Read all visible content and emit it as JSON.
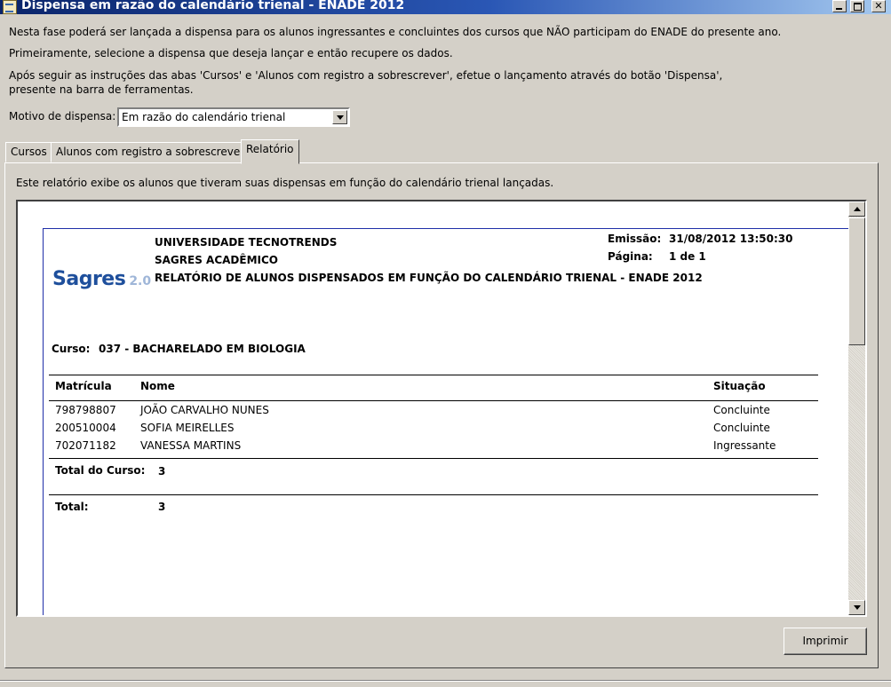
{
  "window": {
    "title": "Dispensa em razão do calendário trienal - ENADE 2012"
  },
  "intro": {
    "line1": "Nesta fase poderá ser lançada a dispensa para os alunos ingressantes e concluintes dos cursos que NÃO participam do ENADE do presente ano.",
    "line2": "Primeiramente, selecione a dispensa que deseja lançar e então recupere os dados.",
    "line3": "Após seguir as instruções das abas 'Cursos' e 'Alunos com registro a sobrescrever', efetue o lançamento através do botão 'Dispensa',",
    "line4": "presente na barra de ferramentas."
  },
  "motivo": {
    "label": "Motivo de dispensa:",
    "value": "Em razão do calendário trienal"
  },
  "tabs": [
    {
      "label": "Cursos"
    },
    {
      "label": "Alunos com registro a sobrescrever"
    },
    {
      "label": "Relatório"
    }
  ],
  "panel": {
    "description": "Este relatório exibe os alunos que tiveram suas dispensas em função do calendário trienal lançadas."
  },
  "report": {
    "logo_text": "Sagres",
    "logo_version": "2.0",
    "institution": "UNIVERSIDADE TECNOTRENDS",
    "system": "SAGRES ACADÊMICO",
    "title": "RELATÓRIO DE ALUNOS DISPENSADOS EM FUNÇÃO DO CALENDÁRIO TRIENAL - ENADE 2012",
    "emissao_label": "Emissão:",
    "emissao_value": "31/08/2012 13:50:30",
    "pagina_label": "Página:",
    "pagina_value": "1 de 1",
    "curso_label": "Curso:",
    "curso_value": "037 - BACHARELADO EM BIOLOGIA",
    "columns": [
      "Matrícula",
      "Nome",
      "Situação"
    ],
    "rows": [
      {
        "matricula": "798798807",
        "nome": "JOÃO CARVALHO NUNES",
        "situacao": "Concluinte"
      },
      {
        "matricula": "200510004",
        "nome": "SOFIA MEIRELLES",
        "situacao": "Concluinte"
      },
      {
        "matricula": "702071182",
        "nome": "VANESSA MARTINS",
        "situacao": "Ingressante"
      }
    ],
    "total_curso_label": "Total do Curso:",
    "total_curso_value": "3",
    "total_label": "Total:",
    "total_value": "3"
  },
  "buttons": {
    "print": "Imprimir"
  }
}
